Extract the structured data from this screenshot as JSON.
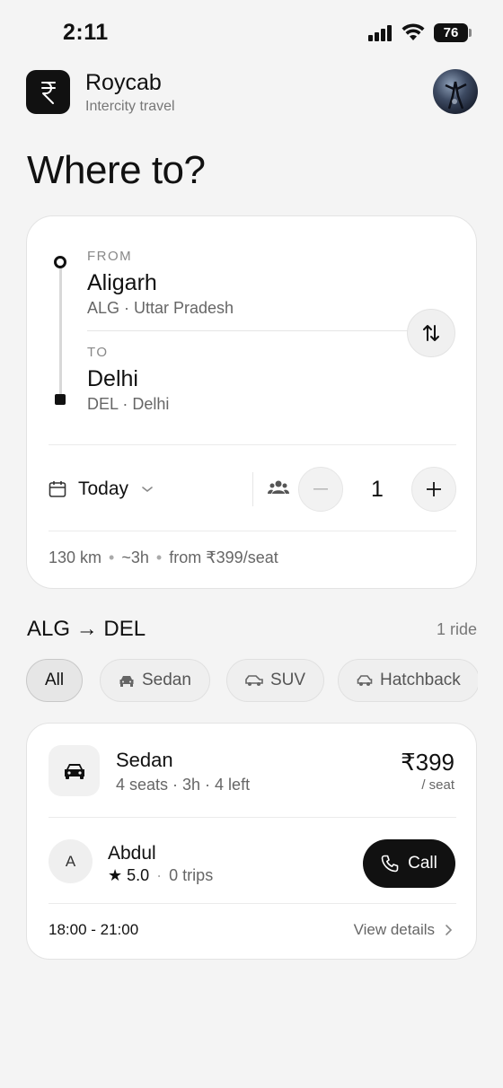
{
  "status_bar": {
    "time": "2:11",
    "battery": "76"
  },
  "header": {
    "app_name": "Roycab",
    "tagline": "Intercity travel"
  },
  "page_title": "Where to?",
  "trip": {
    "from_label": "FROM",
    "from_city": "Aligarh",
    "from_sub": "ALG · Uttar Pradesh",
    "to_label": "TO",
    "to_city": "Delhi",
    "to_sub": "DEL · Delhi",
    "date": "Today",
    "passengers": "1",
    "distance": "130 km",
    "duration": "~3h",
    "fare_from": "from ₹399/seat"
  },
  "results": {
    "route": "ALG → DEL",
    "count": "1 ride",
    "filters": [
      {
        "label": "All",
        "active": true
      },
      {
        "label": "Sedan",
        "icon": "car-icon"
      },
      {
        "label": "SUV",
        "icon": "suv-icon"
      },
      {
        "label": "Hatchback",
        "icon": "car-icon"
      }
    ]
  },
  "ride": {
    "car_type": "Sedan",
    "car_meta": "4 seats · 3h · 4 left",
    "price": "₹399",
    "per_seat": "/ seat",
    "driver_initial": "A",
    "driver_name": "Abdul",
    "rating": "★ 5.0",
    "trips": "0 trips",
    "call_label": "Call",
    "time_window": "18:00 - 21:00",
    "view_details": "View details"
  },
  "colors": {
    "primary": "#111111",
    "background": "#f4f4f4",
    "card": "#ffffff",
    "muted": "#666666"
  }
}
